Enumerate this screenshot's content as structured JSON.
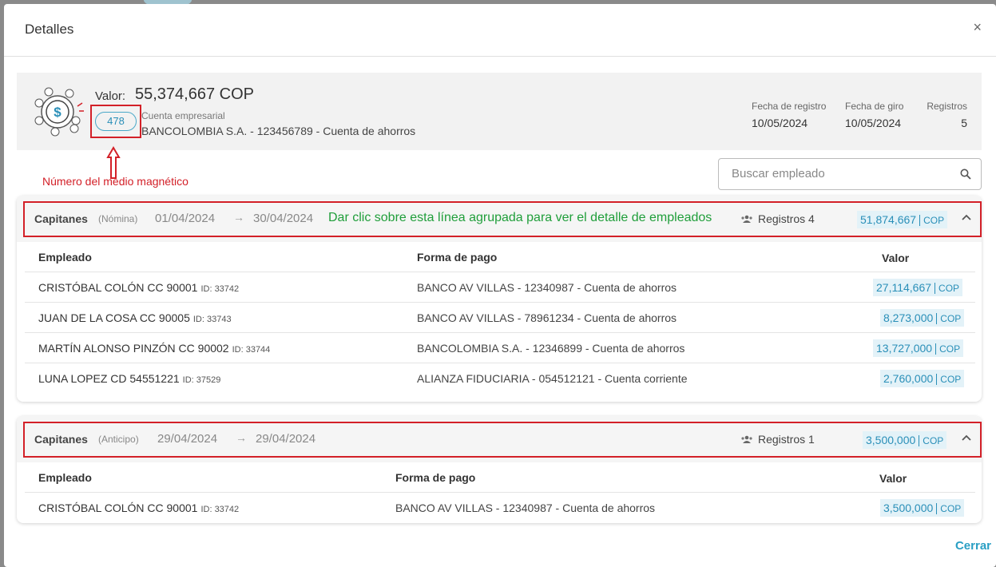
{
  "modal": {
    "title": "Detalles",
    "close_glyph": "×",
    "footer_button": "Cerrar"
  },
  "summary": {
    "valor_label": "Valor:",
    "valor_amount": "55,374,667 COP",
    "medio_number": "478",
    "cuenta_label": "Cuenta empresarial",
    "cuenta_value": "BANCOLOMBIA S.A. - 123456789 - Cuenta de ahorros",
    "fecha_registro_label": "Fecha de registro",
    "fecha_registro": "10/05/2024",
    "fecha_giro_label": "Fecha de giro",
    "fecha_giro": "10/05/2024",
    "registros_label": "Registros",
    "registros": "5",
    "icon": "money-coins-icon"
  },
  "annotations": {
    "medio": "Número del medio magnético",
    "grupo": "Dar clic sobre esta línea agrupada para ver el detalle de empleados"
  },
  "search": {
    "placeholder": "Buscar empleado",
    "icon": "search-icon"
  },
  "table_headers": {
    "empleado": "Empleado",
    "forma_pago": "Forma de pago",
    "valor": "Valor"
  },
  "groups": [
    {
      "title": "Capitanes",
      "type": "(Nómina)",
      "date_from": "01/04/2024",
      "arrow": "→",
      "date_to": "30/04/2024",
      "registros": "Registros 4",
      "amount": "51,874,667",
      "currency": "COP",
      "rows": [
        {
          "name": "CRISTÓBAL COLÓN CC 90001",
          "id": "ID: 33742",
          "payment": "BANCO AV VILLAS - 12340987 - Cuenta de ahorros",
          "amount": "27,114,667",
          "currency": "COP"
        },
        {
          "name": "JUAN DE LA COSA CC 90005",
          "id": "ID: 33743",
          "payment": "BANCO AV VILLAS - 78961234 - Cuenta de ahorros",
          "amount": "8,273,000",
          "currency": "COP"
        },
        {
          "name": "MARTÍN ALONSO PINZÓN CC 90002",
          "id": "ID: 33744",
          "payment": "BANCOLOMBIA S.A. - 12346899 - Cuenta de ahorros",
          "amount": "13,727,000",
          "currency": "COP"
        },
        {
          "name": "LUNA LOPEZ CD 54551221",
          "id": "ID: 37529",
          "payment": "ALIANZA FIDUCIARIA - 054512121 - Cuenta corriente",
          "amount": "2,760,000",
          "currency": "COP"
        }
      ]
    },
    {
      "title": "Capitanes",
      "type": "(Anticipo)",
      "date_from": "29/04/2024",
      "arrow": "→",
      "date_to": "29/04/2024",
      "registros": "Registros 1",
      "amount": "3,500,000",
      "currency": "COP",
      "rows": [
        {
          "name": "CRISTÓBAL COLÓN CC 90001",
          "id": "ID: 33742",
          "payment": "BANCO AV VILLAS - 12340987 - Cuenta de ahorros",
          "amount": "3,500,000",
          "currency": "COP"
        }
      ]
    }
  ],
  "colors": {
    "accent": "#2a8fb8",
    "annotation_red": "#d32028",
    "annotation_green": "#1f9e3a",
    "amount_bg": "#e3f2f8"
  }
}
